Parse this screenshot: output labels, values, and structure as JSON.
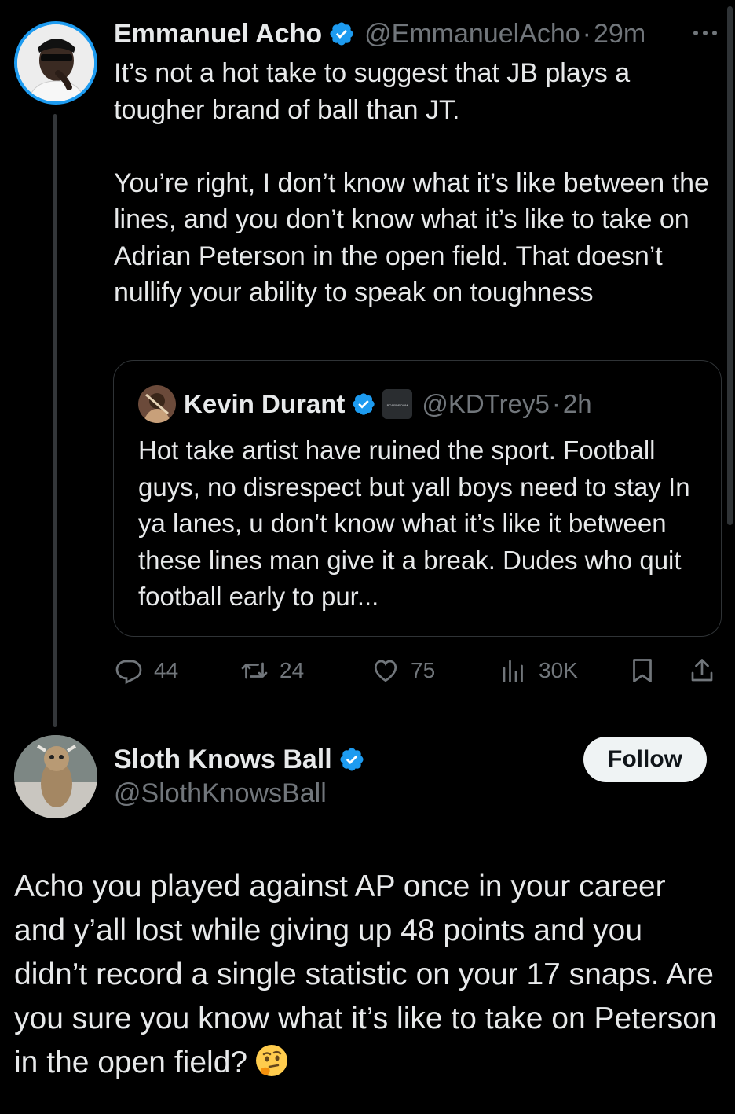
{
  "main_tweet": {
    "display_name": "Emmanuel Acho",
    "handle": "@EmmanuelAcho",
    "separator": "·",
    "time": "29m",
    "more_icon": "more-horizontal-icon",
    "text": "It’s not a hot take to suggest that JB plays a tougher brand of ball than JT.\n\nYou’re right, I don’t know what it’s like between the lines, and you don’t know what it’s like to take on Adrian Peterson in the open field. That doesn’t nullify your ability to speak on toughness",
    "quoted_tweet": {
      "display_name": "Kevin Durant",
      "affiliate_badge_text": "BOARDROOM",
      "handle": "@KDTrey5",
      "separator": "·",
      "time": "2h",
      "text": "Hot take artist have ruined the sport. Football guys, no disrespect but yall boys need to stay In ya lanes, u don’t know what it’s like it between these lines man give it a break. Dudes who quit football early to pur..."
    },
    "actions": {
      "replies": "44",
      "reposts": "24",
      "likes": "75",
      "views": "30K"
    }
  },
  "reply_tweet": {
    "display_name": "Sloth Knows Ball",
    "handle": "@SlothKnowsBall",
    "follow_label": "Follow",
    "text": "Acho you played against AP once in your career and y’all lost while giving up 48 points and you didn’t record a single statistic on your 17 snaps. Are you sure you know what it’s like to take on Peterson in the open field?",
    "emoji": "thinking-face-emoji"
  },
  "colors": {
    "background": "#000000",
    "text": "#e7e9ea",
    "muted": "#71767b",
    "verified": "#1d9bf0",
    "border": "#2f3336"
  }
}
